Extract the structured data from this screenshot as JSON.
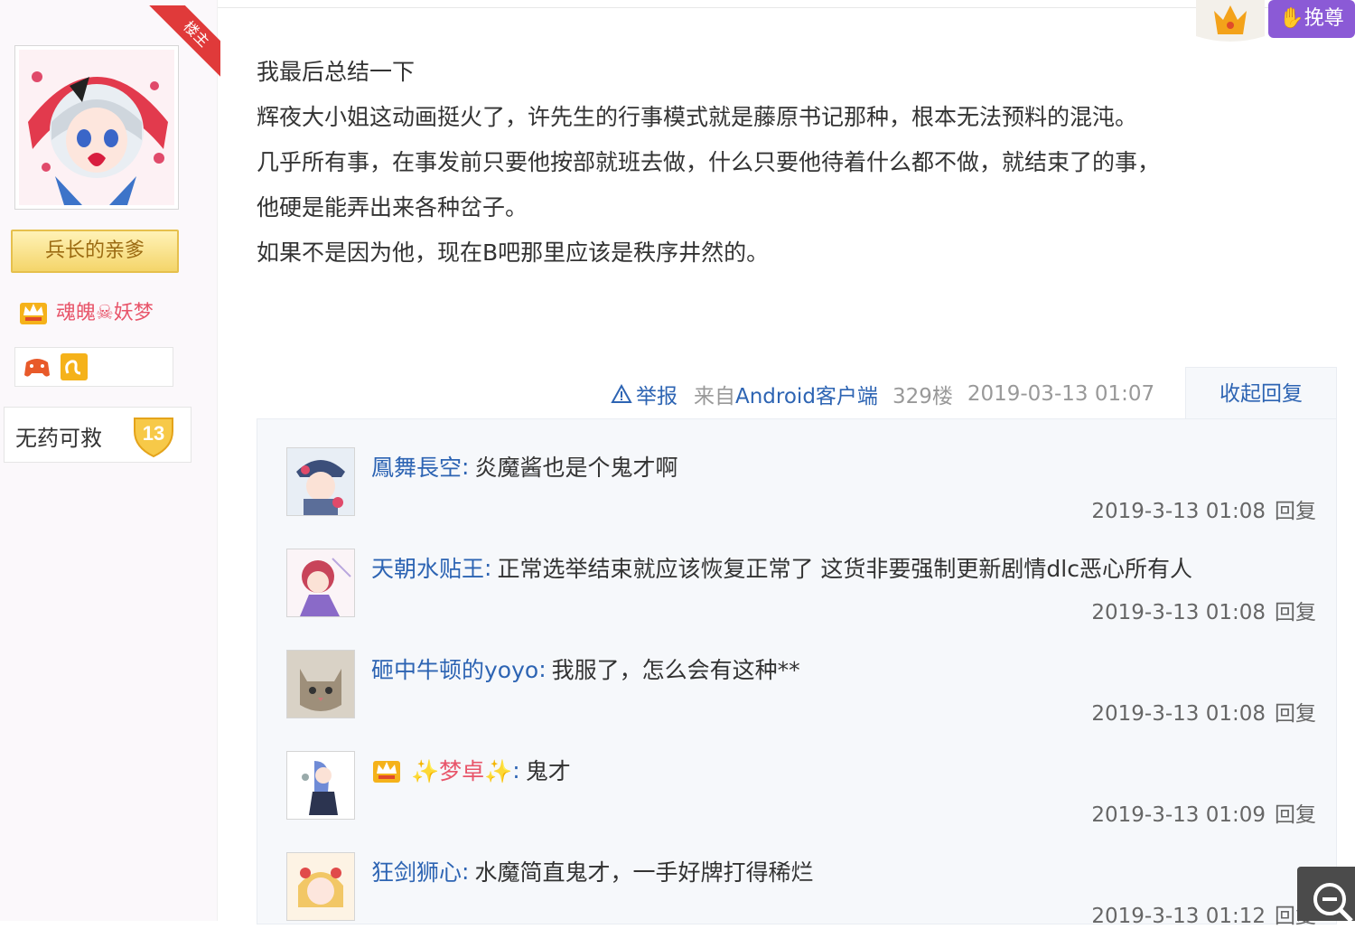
{
  "author": {
    "louzhu_label": "楼主",
    "title_badge": "兵长的亲爹",
    "name": "魂魄☠妖梦",
    "level_text": "无药可救",
    "level_num": "13"
  },
  "top_right": {
    "button_label": "挽尊"
  },
  "post": {
    "lines": [
      "我最后总结一下",
      "辉夜大小姐这动画挺火了，许先生的行事模式就是藤原书记那种，根本无法预料的混沌。",
      "几乎所有事，在事发前只要他按部就班去做，什么只要他待着什么都不做，就结束了的事，",
      "他硬是能弄出来各种岔子。",
      "如果不是因为他，现在B吧那里应该是秩序井然的。"
    ]
  },
  "meta": {
    "report": "举报",
    "source_prefix": "来自",
    "source_client": "Android客户端",
    "floor": "329楼",
    "datetime": "2019-03-13 01:07",
    "collapse": "收起回复"
  },
  "replies": [
    {
      "user": "鳳舞長空",
      "text": "炎魔酱也是个鬼才啊",
      "time": "2019-3-13 01:08",
      "reply": "回复"
    },
    {
      "user": "天朝水贴王",
      "text": "正常选举结束就应该恢复正常了 这货非要强制更新剧情dlc恶心所有人",
      "time": "2019-3-13 01:08",
      "reply": "回复"
    },
    {
      "user": "砸中牛顿的yoyo",
      "text": "我服了，怎么会有这种**",
      "time": "2019-3-13 01:08",
      "reply": "回复"
    },
    {
      "user": "✨梦卓✨",
      "text": "鬼才",
      "time": "2019-3-13 01:09",
      "reply": "回复"
    },
    {
      "user": "狂剑狮心",
      "text": "水魔简直鬼才，一手好牌打得稀烂",
      "time": "2019-3-13 01:12",
      "reply": "回复"
    }
  ],
  "colors": {
    "link": "#2d64b3",
    "vip_name": "#e8556a",
    "louzhu_ribbon": "#e03a3a",
    "wan_button": "#8b5ad6"
  }
}
